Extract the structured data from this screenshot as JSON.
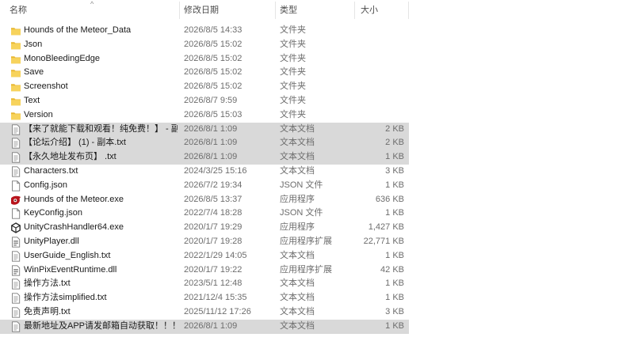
{
  "columns": {
    "name": "名称",
    "date": "修改日期",
    "type": "类型",
    "size": "大小",
    "sort_indicator": "^"
  },
  "files": [
    {
      "name": "Hounds of the Meteor_Data",
      "date": "2026/8/5 14:33",
      "type": "文件夹",
      "size": "",
      "icon": "folder-icon",
      "selected": false
    },
    {
      "name": "Json",
      "date": "2026/8/5 15:02",
      "type": "文件夹",
      "size": "",
      "icon": "folder-icon",
      "selected": false
    },
    {
      "name": "MonoBleedingEdge",
      "date": "2026/8/5 15:02",
      "type": "文件夹",
      "size": "",
      "icon": "folder-icon",
      "selected": false
    },
    {
      "name": "Save",
      "date": "2026/8/5 15:02",
      "type": "文件夹",
      "size": "",
      "icon": "folder-icon",
      "selected": false
    },
    {
      "name": "Screenshot",
      "date": "2026/8/5 15:02",
      "type": "文件夹",
      "size": "",
      "icon": "folder-icon",
      "selected": false
    },
    {
      "name": "Text",
      "date": "2026/8/7 9:59",
      "type": "文件夹",
      "size": "",
      "icon": "folder-icon",
      "selected": false
    },
    {
      "name": "Version",
      "date": "2026/8/5 15:03",
      "type": "文件夹",
      "size": "",
      "icon": "folder-icon",
      "selected": false
    },
    {
      "name": "【来了就能下载和观看！纯免费！】 - 副...",
      "date": "2026/8/1 1:09",
      "type": "文本文档",
      "size": "2 KB",
      "icon": "text-file-icon",
      "selected": true
    },
    {
      "name": "【论坛介绍】 (1) - 副本.txt",
      "date": "2026/8/1 1:09",
      "type": "文本文档",
      "size": "2 KB",
      "icon": "text-file-icon",
      "selected": true
    },
    {
      "name": "【永久地址发布页】 .txt",
      "date": "2026/8/1 1:09",
      "type": "文本文档",
      "size": "1 KB",
      "icon": "text-file-icon",
      "selected": true
    },
    {
      "name": "Characters.txt",
      "date": "2024/3/25 15:16",
      "type": "文本文档",
      "size": "3 KB",
      "icon": "text-file-icon",
      "selected": false
    },
    {
      "name": "Config.json",
      "date": "2026/7/2 19:34",
      "type": "JSON 文件",
      "size": "1 KB",
      "icon": "json-file-icon",
      "selected": false
    },
    {
      "name": "Hounds of the Meteor.exe",
      "date": "2026/8/5 13:37",
      "type": "应用程序",
      "size": "636 KB",
      "icon": "game-exe-icon",
      "selected": false
    },
    {
      "name": "KeyConfig.json",
      "date": "2022/7/4 18:28",
      "type": "JSON 文件",
      "size": "1 KB",
      "icon": "json-file-icon",
      "selected": false
    },
    {
      "name": "UnityCrashHandler64.exe",
      "date": "2020/1/7 19:29",
      "type": "应用程序",
      "size": "1,427 KB",
      "icon": "unity-icon",
      "selected": false
    },
    {
      "name": "UnityPlayer.dll",
      "date": "2020/1/7 19:28",
      "type": "应用程序扩展",
      "size": "22,771 KB",
      "icon": "dll-file-icon",
      "selected": false
    },
    {
      "name": "UserGuide_English.txt",
      "date": "2022/1/29 14:05",
      "type": "文本文档",
      "size": "1 KB",
      "icon": "text-file-icon",
      "selected": false
    },
    {
      "name": "WinPixEventRuntime.dll",
      "date": "2020/1/7 19:22",
      "type": "应用程序扩展",
      "size": "42 KB",
      "icon": "dll-file-icon",
      "selected": false
    },
    {
      "name": "操作方法.txt",
      "date": "2023/5/1 12:48",
      "type": "文本文档",
      "size": "1 KB",
      "icon": "text-file-icon",
      "selected": false
    },
    {
      "name": "操作方法simplified.txt",
      "date": "2021/12/4 15:35",
      "type": "文本文档",
      "size": "1 KB",
      "icon": "text-file-icon",
      "selected": false
    },
    {
      "name": "免责声明.txt",
      "date": "2025/11/12 17:26",
      "type": "文本文档",
      "size": "3 KB",
      "icon": "text-file-icon",
      "selected": false
    },
    {
      "name": "最新地址及APP请发邮箱自动获取！！！...",
      "date": "2026/8/1 1:09",
      "type": "文本文档",
      "size": "1 KB",
      "icon": "text-file-icon",
      "selected": true
    }
  ],
  "colors": {
    "selection": "#d9d9d9",
    "folder": "#f0c53a",
    "exe_accent": "#b8141c"
  }
}
